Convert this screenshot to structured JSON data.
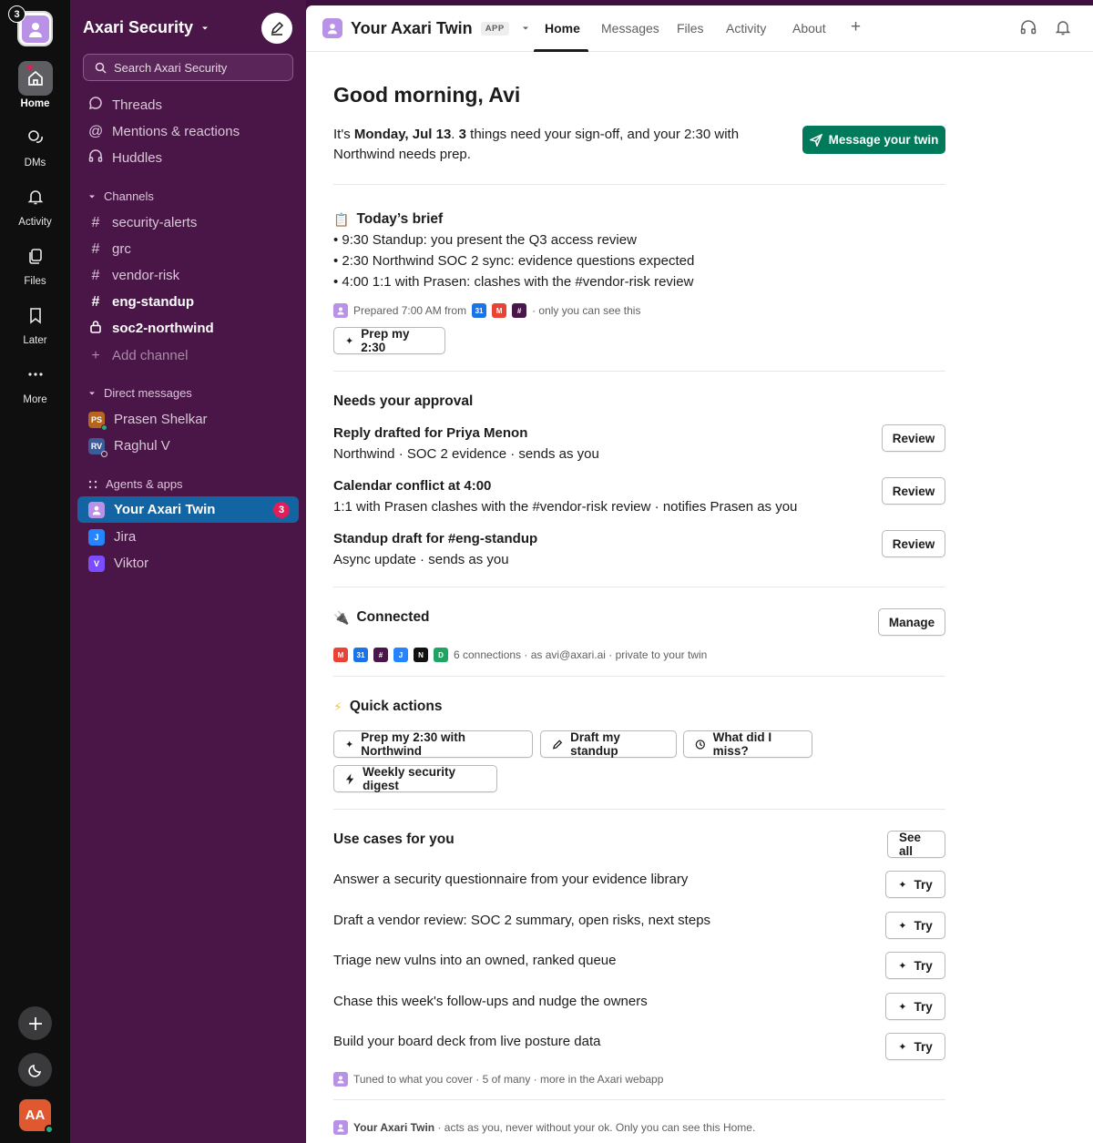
{
  "rail": {
    "workspace_badge": "3",
    "items": [
      {
        "label": "Home",
        "icon": "home-icon"
      },
      {
        "label": "DMs",
        "icon": "dms-icon"
      },
      {
        "label": "Activity",
        "icon": "bell-icon"
      },
      {
        "label": "Files",
        "icon": "files-icon"
      },
      {
        "label": "Later",
        "icon": "bookmark-icon"
      },
      {
        "label": "More",
        "icon": "more-icon"
      }
    ],
    "user_initials": "AA"
  },
  "sidebar": {
    "workspace_name": "Axari Security",
    "search_placeholder": "Search Axari Security",
    "nav": [
      "Threads",
      "Mentions & reactions",
      "Huddles"
    ],
    "channels_header": "Channels",
    "channels": [
      {
        "name": "security-alerts",
        "bold": false
      },
      {
        "name": "grc",
        "bold": false
      },
      {
        "name": "vendor-risk",
        "bold": false
      },
      {
        "name": "eng-standup",
        "bold": true
      },
      {
        "name": "soc2-northwind",
        "bold": true,
        "locked": true
      }
    ],
    "add_channel": "Add channel",
    "dms_header": "Direct messages",
    "dms": [
      {
        "name": "Prasen Shelkar",
        "initials": "PS",
        "color": "#b5651d"
      },
      {
        "name": "Raghul V",
        "initials": "RV",
        "color": "#3d5a99"
      }
    ],
    "agents_header": "Agents & apps",
    "agents": [
      {
        "name": "Your Axari Twin",
        "badge": "3"
      },
      {
        "name": "Jira",
        "initials": "J",
        "color": "#2684ff"
      },
      {
        "name": "Viktor",
        "initials": "V",
        "color": "#7c4dff"
      }
    ]
  },
  "topbar": {
    "title": "Your Axari Twin",
    "tag": "APP",
    "tabs": [
      "Home",
      "Messages",
      "Files",
      "Activity",
      "About"
    ],
    "add": "+"
  },
  "home": {
    "greeting": "Good morning, Avi",
    "intro_pre": "It's ",
    "intro_date": "Monday, Jul 13",
    "intro_mid": ". ",
    "intro_count": "3",
    "intro_rest": " things need your sign-off, and your 2:30 with Northwind needs prep.",
    "message_button": "Message your twin",
    "brief": {
      "emoji": "📋",
      "title": "Today’s brief",
      "items": [
        "• 9:30 Standup: you present the Q3 access review",
        "• 2:30 Northwind SOC 2 sync: evidence questions expected",
        "• 4:00 1:1 with Prasen: clashes with the #vendor-risk review"
      ],
      "meta_pre": "Prepared 7:00 AM from",
      "meta_post": "· only you can see this",
      "sources": [
        "31",
        "M",
        "#"
      ],
      "button": "Prep my 2:30"
    },
    "approval": {
      "title": "Needs your approval",
      "rows": [
        {
          "title": "Reply drafted for Priya Menon",
          "sub": "Northwind · SOC 2 evidence · sends as you",
          "button": "Review"
        },
        {
          "title": "Calendar conflict at 4:00",
          "sub": "1:1 with Prasen clashes with the #vendor-risk review · notifies Prasen as you",
          "button": "Review"
        },
        {
          "title": "Standup draft for #eng-standup",
          "sub": "Async update · sends as you",
          "button": "Review"
        }
      ]
    },
    "connected": {
      "emoji": "🔌",
      "title": "Connected",
      "button": "Manage",
      "chips": [
        "M",
        "31",
        "#",
        "J",
        "N",
        "D"
      ],
      "meta": "6 connections · as avi@axari.ai · private to your twin"
    },
    "quick": {
      "emoji": "⚡",
      "title": "Quick actions",
      "buttons": [
        "Prep my 2:30 with Northwind",
        "Draft my standup",
        "What did I miss?",
        "Weekly security digest"
      ]
    },
    "usecases": {
      "title": "Use cases for you",
      "see_all": "See all",
      "try_label": "Try",
      "items": [
        "Answer a security questionnaire from your evidence library",
        "Draft a vendor review: SOC 2 summary, open risks, next steps",
        "Triage new vulns into an owned, ranked queue",
        "Chase this week's follow-ups and nudge the owners",
        "Build your board deck from live posture data"
      ],
      "footer": "Tuned to what you cover · 5 of many · more in the Axari webapp"
    },
    "footer_name": "Your Axari Twin",
    "footer_rest": " · acts as you, never without your ok. Only you can see this Home."
  },
  "colors": {
    "rail": "#0f0f10",
    "sidebar": "#4a1547",
    "active": "#1264a3",
    "primary": "#007a5a",
    "badge": "#e01e5a"
  }
}
